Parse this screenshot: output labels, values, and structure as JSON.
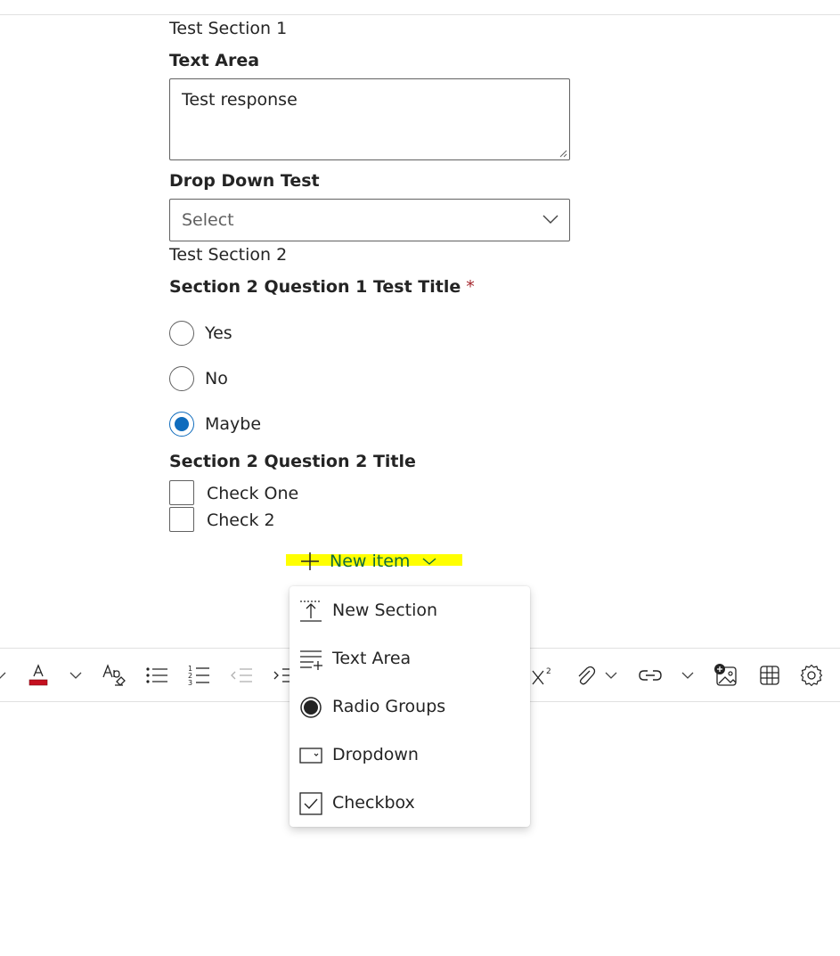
{
  "form": {
    "section1_title": "Test Section 1",
    "q1_label": "Text Area",
    "q1_value": "Test response",
    "q2_label": "Drop Down Test",
    "q2_placeholder": "Select",
    "section2_title": "Test Section 2",
    "q3_label": "Section 2 Question 1 Test Title",
    "q3_required_mark": "*",
    "q3_options": [
      {
        "label": "Yes",
        "checked": false
      },
      {
        "label": "No",
        "checked": false
      },
      {
        "label": "Maybe",
        "checked": true
      }
    ],
    "q4_label": "Section 2 Question 2 Title",
    "q4_options": [
      {
        "label": "Check One",
        "checked": false
      },
      {
        "label": "Check 2",
        "checked": false
      }
    ]
  },
  "new_item": {
    "label": "New item",
    "highlight_color": "#ffff00",
    "text_color": "#0f6b3f"
  },
  "menu": {
    "items": [
      {
        "label": "New Section",
        "icon": "insert-section-icon"
      },
      {
        "label": "Text Area",
        "icon": "text-area-icon"
      },
      {
        "label": "Radio Groups",
        "icon": "radio-icon"
      },
      {
        "label": "Dropdown",
        "icon": "dropdown-icon"
      },
      {
        "label": "Checkbox",
        "icon": "checkbox-icon"
      }
    ]
  },
  "toolbar": {
    "font_color_bar": "#c50f1f",
    "items": [
      "chevron-down-icon",
      "font-color-icon",
      "chevron-down-icon",
      "clear-format-icon",
      "bullets-icon",
      "numbering-icon",
      "decrease-indent-icon",
      "increase-indent-icon",
      "superscript-icon",
      "attach-icon",
      "chevron-down-icon",
      "link-icon",
      "chevron-down-icon",
      "image-icon",
      "table-icon",
      "settings-icon"
    ]
  },
  "colors": {
    "accent": "#0f6cbd",
    "required": "#a4262c",
    "border": "#616161"
  }
}
